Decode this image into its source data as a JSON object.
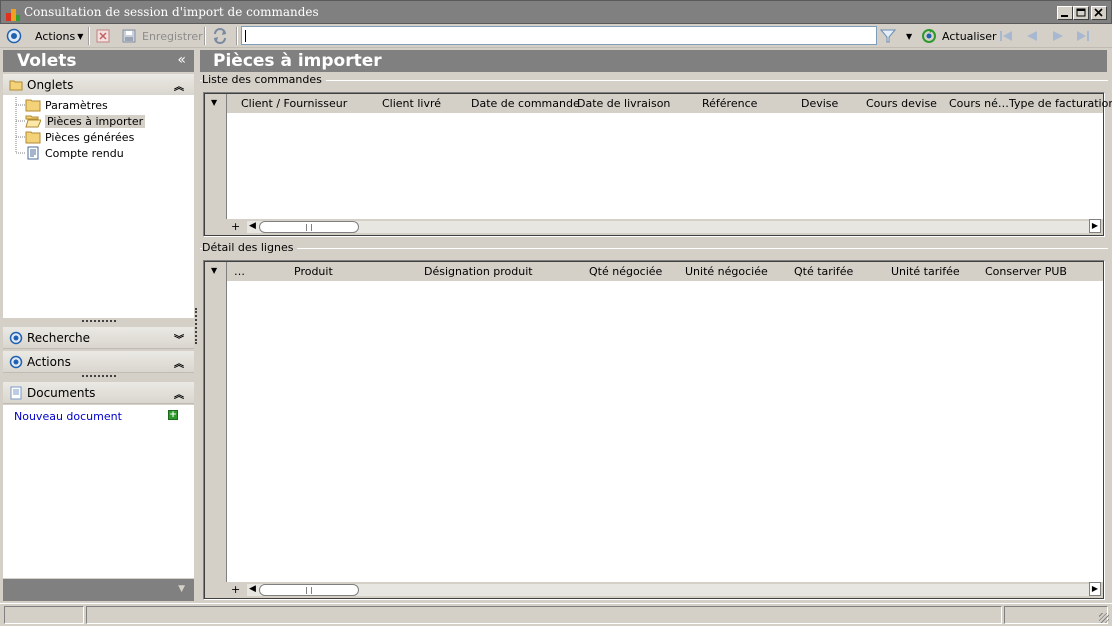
{
  "window": {
    "title": "Consultation de session d'import de commandes"
  },
  "toolbar": {
    "actions_label": "Actions",
    "save_label": "Enregistrer",
    "search_value": "",
    "refresh_label": "Actualiser"
  },
  "left_panel": {
    "header": "Volets",
    "collapse_glyph": "«",
    "onglets": {
      "label": "Onglets",
      "items": [
        {
          "label": "Paramètres",
          "icon": "folder-icon"
        },
        {
          "label": "Pièces à importer",
          "icon": "folder-open-icon",
          "selected": true
        },
        {
          "label": "Pièces générées",
          "icon": "folder-icon"
        },
        {
          "label": "Compte rendu",
          "icon": "document-icon"
        }
      ]
    },
    "recherche_label": "Recherche",
    "actions_label": "Actions",
    "documents": {
      "label": "Documents",
      "new_document": "Nouveau document"
    }
  },
  "main": {
    "title": "Pièces à importer",
    "orders_group": {
      "label": "Liste des commandes",
      "columns": [
        "Client / Fournisseur",
        "Client livré",
        "Date de commande",
        "Date de livraison",
        "Référence",
        "Devise",
        "Cours devise",
        "Cours né…",
        "Type de facturation"
      ]
    },
    "lines_group": {
      "label": "Détail des lignes",
      "columns": [
        "…",
        "Produit",
        "Désignation produit",
        "Qté négociée",
        "Unité négociée",
        "Qté tarifée",
        "Unité tarifée",
        "Conserver PUB"
      ]
    }
  },
  "colors": {
    "header_gray": "#808080",
    "link_blue": "#0000cc",
    "chrome": "#d4d0c8"
  }
}
